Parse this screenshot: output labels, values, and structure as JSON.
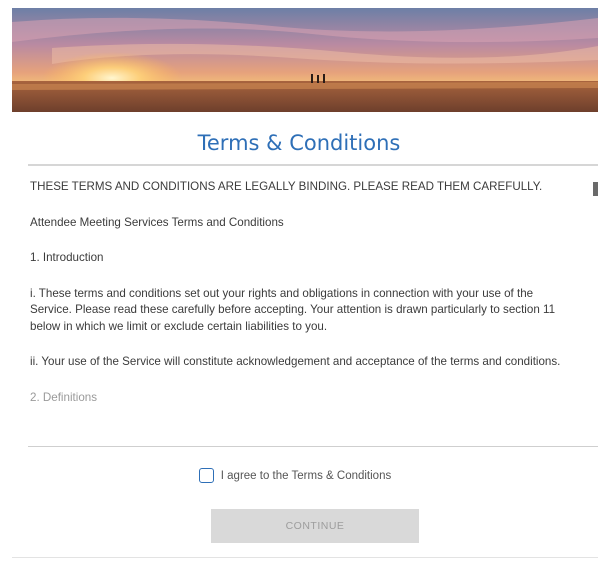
{
  "banner": {
    "image_name": "sunset-desert-banner"
  },
  "title": "Terms & Conditions",
  "terms": {
    "paragraphs": [
      "THESE TERMS AND CONDITIONS ARE LEGALLY BINDING. PLEASE READ THEM CAREFULLY.",
      "Attendee Meeting Services Terms and Conditions",
      "1. Introduction",
      "i.   These terms and conditions set out your rights and obligations in connection with your use of the Service. Please read these carefully before accepting. Your attention is drawn particularly to section 11 below in which we limit or exclude certain liabilities to you.",
      "ii.   Your use of the Service will constitute acknowledgement and acceptance of the terms and conditions.",
      "2. Definitions"
    ]
  },
  "agreement": {
    "label": "I agree to the Terms & Conditions",
    "checked": false
  },
  "continue_button": {
    "label": "CONTINUE",
    "enabled": false
  },
  "colors": {
    "title": "#2e6fb7",
    "checkbox_border": "#2e6fb7",
    "button_bg": "#d9d9d9"
  }
}
